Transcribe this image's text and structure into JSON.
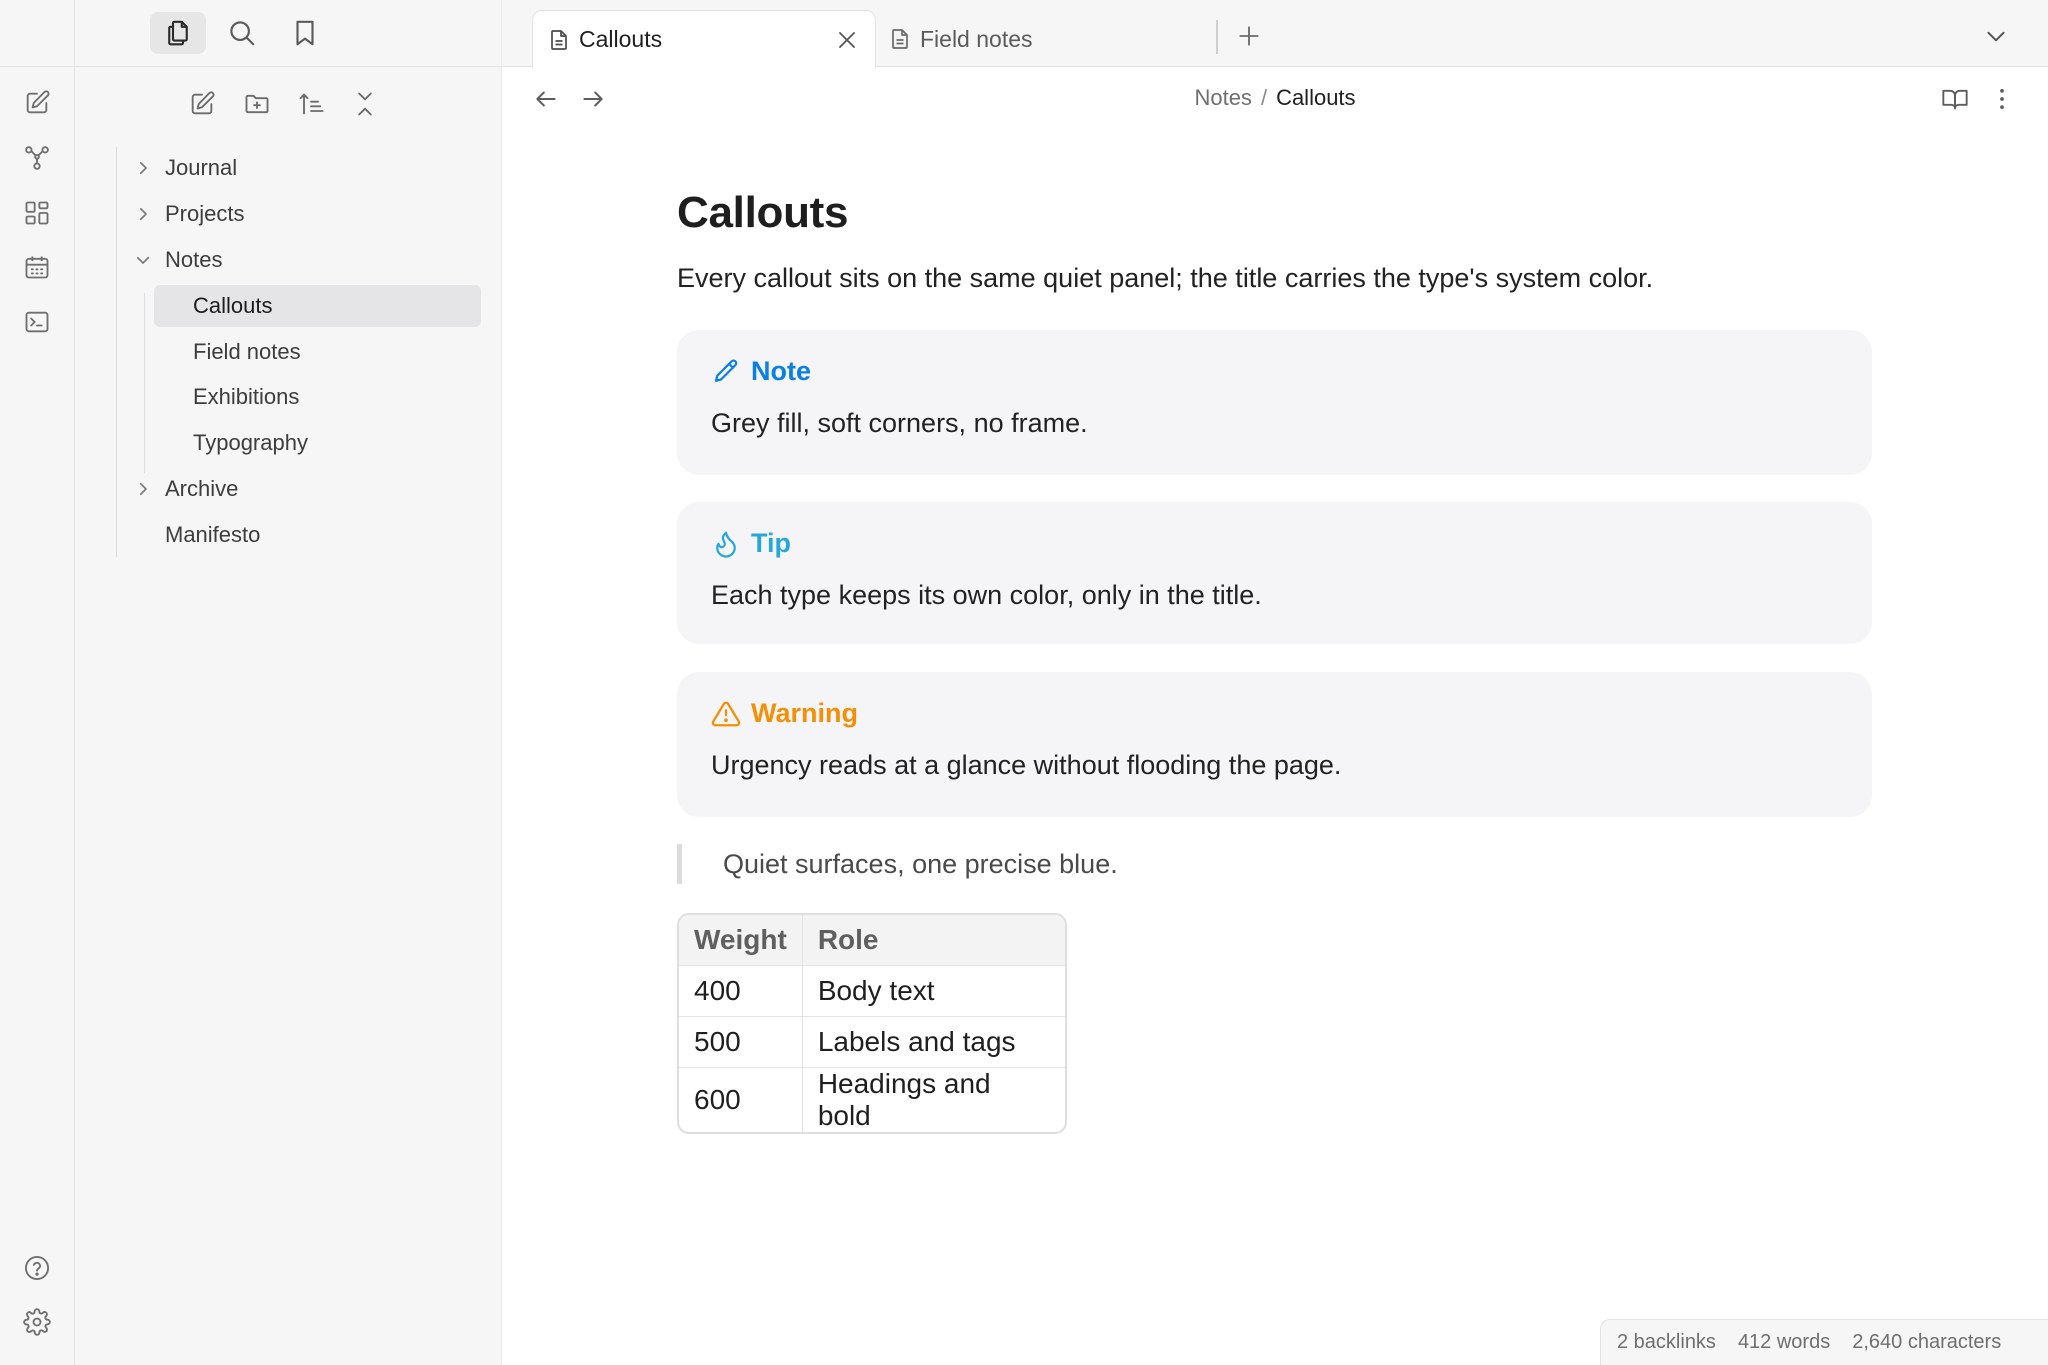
{
  "tabs": [
    {
      "label": "Callouts",
      "active": true
    },
    {
      "label": "Field notes",
      "active": false
    }
  ],
  "sidebar": {
    "tree": [
      {
        "label": "Journal",
        "type": "folder",
        "expanded": false
      },
      {
        "label": "Projects",
        "type": "folder",
        "expanded": false
      },
      {
        "label": "Notes",
        "type": "folder",
        "expanded": true
      },
      {
        "label": "Callouts",
        "type": "file",
        "selected": true
      },
      {
        "label": "Field notes",
        "type": "file"
      },
      {
        "label": "Exhibitions",
        "type": "file"
      },
      {
        "label": "Typography",
        "type": "file"
      },
      {
        "label": "Archive",
        "type": "folder",
        "expanded": false
      },
      {
        "label": "Manifesto",
        "type": "file"
      }
    ]
  },
  "breadcrumb": {
    "parent": "Notes",
    "separator": "/",
    "current": "Callouts"
  },
  "note": {
    "title": "Callouts",
    "intro": "Every callout sits on the same quiet panel; the title carries the type's system color.",
    "callouts": [
      {
        "type": "note",
        "title": "Note",
        "icon": "pencil-icon",
        "color": "#0a7fe6",
        "body": "Grey fill, soft corners, no frame."
      },
      {
        "type": "tip",
        "title": "Tip",
        "icon": "flame-icon",
        "color": "#26a8d8",
        "body": "Each type keeps its own color, only in the title."
      },
      {
        "type": "warning",
        "title": "Warning",
        "icon": "warning-icon",
        "color": "#f29007",
        "body": "Urgency reads at a glance without flooding the page."
      }
    ],
    "quote": "Quiet surfaces, one precise blue.",
    "table": {
      "headers": [
        "Weight",
        "Role"
      ],
      "rows": [
        [
          "400",
          "Body text"
        ],
        [
          "500",
          "Labels and tags"
        ],
        [
          "600",
          "Headings and bold"
        ]
      ]
    }
  },
  "status": {
    "backlinks": "2 backlinks",
    "words": "412 words",
    "characters": "2,640 characters"
  },
  "colors": {
    "accent": "#0a7fe6",
    "panel": "#f5f5f7",
    "sidebar_bg": "#f6f6f6"
  }
}
